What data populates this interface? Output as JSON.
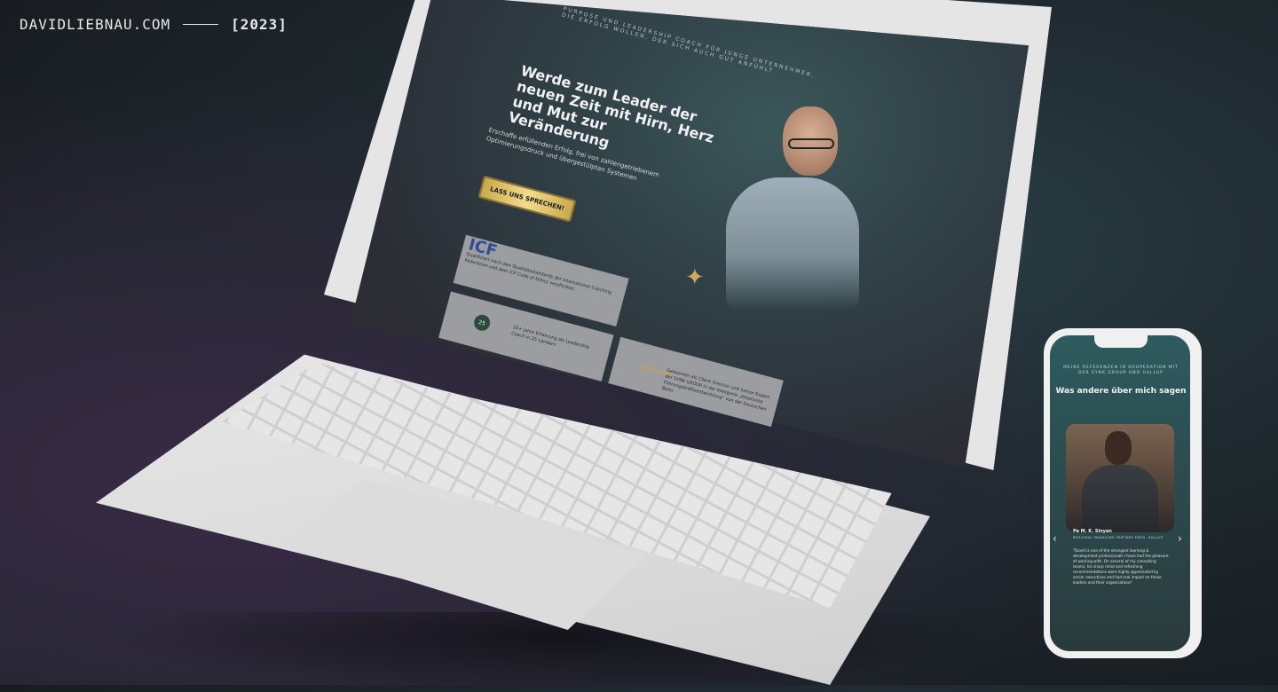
{
  "header": {
    "site": "DAVIDLIEBNAU.COM",
    "year": "[2023]"
  },
  "laptop": {
    "tagline": "PURPOSE UND LEADERSHIP COACH FÜR JUNGE UNTERNEHMER, DIE ERFOLG WOLLEN, DER SICH AUCH GUT ANFÜHLT",
    "hero_title": "Werde zum Leader der neuen Zeit mit Hirn, Herz und Mut zur Veränderung",
    "hero_subtitle": "Erschaffe erfüllenden Erfolg, frei von zahlengetriebenem Optimierungsdruck und übergestülpten Systemen",
    "cta_label": "LASS UNS SPRECHEN!",
    "cards": {
      "icf_logo": "ICF",
      "icf_text": "Qualifiziert nach den Qualitätsstandards der International Coaching Federation und dem ICF Code of Ethics verpflichtet",
      "experience_badge": "25",
      "experience_text": "25+ Jahre Erfahrung als Leadership Coach in 25 Ländern",
      "cert_seal": "ZERTIFIZIERT",
      "cert_text": "Gewonnen als Client Director und Senior Expert der SYNK GROUP in der Kategorie „Kreativste Führungskräfteentwicklung“ von der Deutschen Bahn"
    }
  },
  "phone": {
    "eyebrow": "MEINE REFERENZEN IN KOOPERATION MIT DER SYNK GROUP UND GALLUP",
    "title": "Was andere über mich sagen",
    "name": "Pa M. K. Sinyan",
    "role": "REGIONAL MANAGING PARTNER EMEA, GALLUP",
    "quote": "\"David is one of the strongest learning & development professionals I have had the pleasure of working with. On several of my consulting teams, his sharp mind and refreshing recommendations were highly appreciated by senior executives and had real impact on these leaders and their organisations\"",
    "prev_icon": "‹",
    "next_icon": "›"
  },
  "colors": {
    "cta_gold": "#f3dc8d",
    "phone_teal": "#2d5b5f",
    "device_white": "#e5e5e5"
  }
}
